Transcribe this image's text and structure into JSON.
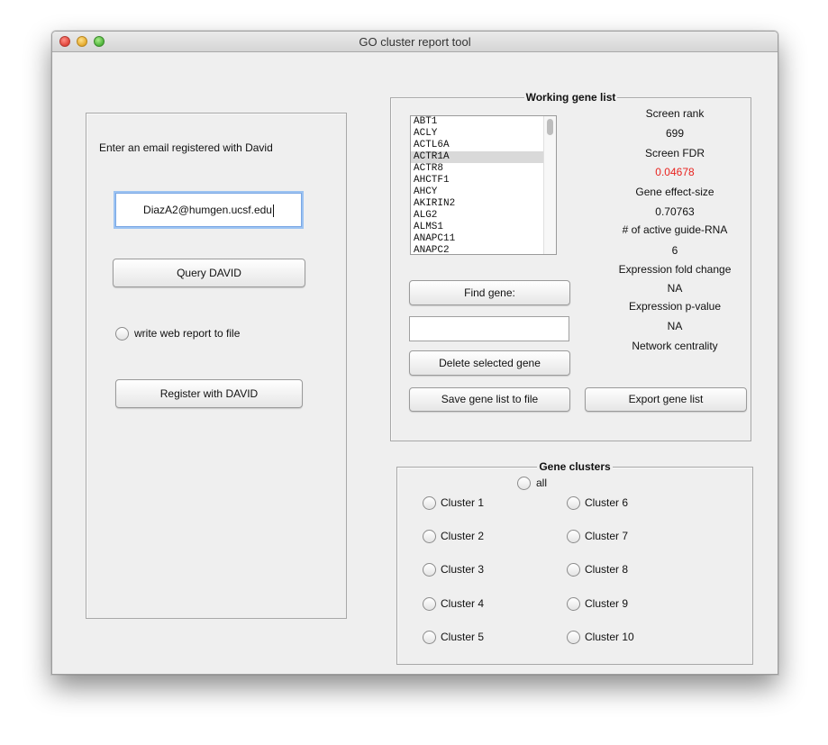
{
  "window": {
    "title": "GO cluster report tool"
  },
  "left_panel": {
    "instruction": "Enter an email registered with David",
    "email_value": "DiazA2@humgen.ucsf.edu",
    "query_button": "Query DAVID",
    "write_report_label": "write web report to file",
    "register_button": "Register with DAVID"
  },
  "working": {
    "title": "Working gene list",
    "genes": [
      "ABT1",
      "ACLY",
      "ACTL6A",
      "ACTR1A",
      "ACTR8",
      "AHCTF1",
      "AHCY",
      "AKIRIN2",
      "ALG2",
      "ALMS1",
      "ANAPC11",
      "ANAPC2"
    ],
    "selected_gene": "ACTR1A",
    "stats": {
      "screen_rank_label": "Screen rank",
      "screen_rank": "699",
      "screen_fdr_label": "Screen FDR",
      "screen_fdr": "0.04678",
      "effect_size_label": "Gene effect-size",
      "effect_size": "0.70763",
      "guides_label": "# of active guide-RNA",
      "guides": "6",
      "fold_change_label": "Expression fold change",
      "fold_change": "NA",
      "pvalue_label": "Expression p-value",
      "pvalue": "NA",
      "centrality_label": "Network centrality"
    },
    "find_button": "Find gene:",
    "find_value": "",
    "delete_button": "Delete selected gene",
    "save_button": "Save gene list to file",
    "export_button": "Export gene list"
  },
  "clusters": {
    "title": "Gene clusters",
    "all_label": "all",
    "items": [
      "Cluster 1",
      "Cluster 2",
      "Cluster 3",
      "Cluster 4",
      "Cluster 5",
      "Cluster 6",
      "Cluster 7",
      "Cluster 8",
      "Cluster 9",
      "Cluster 10"
    ]
  },
  "colors": {
    "fdr_value": "#e8231f",
    "focus_ring": "#9cc3f2"
  }
}
